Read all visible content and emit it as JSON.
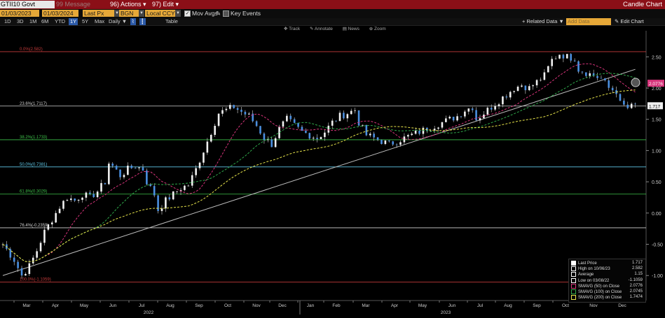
{
  "title_bar": {
    "ticker": "GTII10 Govt",
    "ghost_text": "Message",
    "ghost_prefix": "99",
    "actions_num": "96",
    "actions_label": "Actions",
    "edit_num": "97",
    "edit_label": "Edit",
    "window_title": "Candle Chart"
  },
  "controls": {
    "start_date": "01/03/2023",
    "end_date": "01/03/2024",
    "price_field": "Last Px",
    "source_field": "BGN",
    "currency_field": "Local CCY",
    "mov_avgs_label": "Mov Avgs",
    "key_events_label": "Key Events"
  },
  "periods": [
    "1D",
    "3D",
    "1M",
    "6M",
    "YTD",
    "1Y",
    "5Y",
    "Max"
  ],
  "active_period": "1Y",
  "frequency": "Daily",
  "table_label": "Table",
  "related_data": "Related Data",
  "add_data_placeholder": "Add Data",
  "edit_chart": "Edit Chart",
  "chart_tools": [
    "Track",
    "Annotate",
    "News",
    "Zoom"
  ],
  "colors": {
    "title_bar": "#8b0f17",
    "field": "#e6a838",
    "candle": "#4a8fe0",
    "sma50": "#d6347a",
    "sma100": "#2fa84a",
    "sma200": "#e6e34a",
    "trendline": "#bdbdbd"
  },
  "chart_data": {
    "type": "candlestick",
    "y_ticks": [
      "2.50",
      "2.00",
      "1.50",
      "1.00",
      "0.50",
      "0.00",
      "-0.50",
      "-1.00"
    ],
    "ylim": [
      -1.4,
      2.85
    ],
    "x_month_labels": [
      "Mar",
      "Apr",
      "May",
      "Jun",
      "Jul",
      "Aug",
      "Sep",
      "Oct",
      "Nov",
      "Dec",
      "Jan",
      "Feb",
      "Mar",
      "Apr",
      "May",
      "Jun",
      "Jul",
      "Aug",
      "Sep",
      "Oct",
      "Nov",
      "Dec"
    ],
    "x_year_labels": [
      "2022",
      "2023"
    ],
    "fib_levels": [
      {
        "label": "0.0%(2.582)",
        "value": 2.582,
        "color": "#c43a3a"
      },
      {
        "label": "23.6%(1.7117)",
        "value": 1.7117,
        "color": "#d0d0d0"
      },
      {
        "label": "38.2%(1.1733)",
        "value": 1.1733,
        "color": "#3ec24a"
      },
      {
        "label": "50.0%(0.7381)",
        "value": 0.7381,
        "color": "#5fc8e8"
      },
      {
        "label": "61.8%(0.3029)",
        "value": 0.3029,
        "color": "#3ec24a"
      },
      {
        "label": "76.4%(-0.2359)",
        "value": -0.2359,
        "color": "#d0d0d0"
      },
      {
        "label": "100.0%(-1.1059)",
        "value": -1.1059,
        "color": "#c43a3a"
      }
    ],
    "price_path": [
      [
        0,
        -0.5
      ],
      [
        3,
        -0.75
      ],
      [
        5,
        -1.0
      ],
      [
        7,
        -0.85
      ],
      [
        9,
        -0.6
      ],
      [
        11,
        -0.3
      ],
      [
        13,
        -0.1
      ],
      [
        15,
        0.1
      ],
      [
        17,
        0.25
      ],
      [
        19,
        0.2
      ],
      [
        21,
        0.3
      ],
      [
        23,
        0.25
      ],
      [
        25,
        0.35
      ],
      [
        27,
        0.5
      ],
      [
        28,
        0.8
      ],
      [
        29,
        0.75
      ],
      [
        31,
        0.6
      ],
      [
        33,
        0.7
      ],
      [
        35,
        0.75
      ],
      [
        37,
        0.7
      ],
      [
        38,
        0.5
      ],
      [
        40,
        0.3
      ],
      [
        41,
        0.05
      ],
      [
        43,
        0.2
      ],
      [
        45,
        0.3
      ],
      [
        47,
        0.4
      ],
      [
        49,
        0.45
      ],
      [
        51,
        0.7
      ],
      [
        53,
        1.0
      ],
      [
        55,
        1.3
      ],
      [
        57,
        1.6
      ],
      [
        59,
        1.65
      ],
      [
        61,
        1.7
      ],
      [
        63,
        1.62
      ],
      [
        65,
        1.55
      ],
      [
        67,
        1.4
      ],
      [
        69,
        1.2
      ],
      [
        71,
        1.1
      ],
      [
        73,
        1.35
      ],
      [
        75,
        1.5
      ],
      [
        77,
        1.4
      ],
      [
        79,
        1.3
      ],
      [
        81,
        1.25
      ],
      [
        83,
        1.2
      ],
      [
        85,
        1.3
      ],
      [
        87,
        1.45
      ],
      [
        89,
        1.55
      ],
      [
        91,
        1.6
      ],
      [
        93,
        1.65
      ],
      [
        94,
        1.45
      ],
      [
        96,
        1.25
      ],
      [
        98,
        1.2
      ],
      [
        100,
        1.15
      ],
      [
        102,
        1.1
      ],
      [
        104,
        1.15
      ],
      [
        106,
        1.2
      ],
      [
        108,
        1.25
      ],
      [
        110,
        1.3
      ],
      [
        112,
        1.35
      ],
      [
        114,
        1.4
      ],
      [
        116,
        1.45
      ],
      [
        118,
        1.5
      ],
      [
        120,
        1.55
      ],
      [
        122,
        1.65
      ],
      [
        124,
        1.7
      ],
      [
        125,
        1.5
      ],
      [
        127,
        1.6
      ],
      [
        129,
        1.7
      ],
      [
        131,
        1.8
      ],
      [
        133,
        1.9
      ],
      [
        135,
        2.0
      ],
      [
        137,
        2.05
      ],
      [
        139,
        2.0
      ],
      [
        141,
        2.1
      ],
      [
        143,
        2.2
      ],
      [
        145,
        2.45
      ],
      [
        147,
        2.55
      ],
      [
        149,
        2.5
      ],
      [
        151,
        2.48
      ],
      [
        152,
        2.3
      ],
      [
        154,
        2.25
      ],
      [
        156,
        2.2
      ],
      [
        158,
        2.15
      ],
      [
        160,
        2.0
      ],
      [
        162,
        1.95
      ],
      [
        163,
        1.75
      ],
      [
        165,
        1.68
      ],
      [
        167,
        1.72
      ]
    ],
    "last_price_tag": "1.717",
    "sma100_tag": "2.0776",
    "legend": [
      {
        "label": "Last Price",
        "value": "1.717"
      },
      {
        "label": "High on 10/06/23",
        "value": "2.582"
      },
      {
        "label": "Average",
        "value": "1.15"
      },
      {
        "label": "Low on 03/08/22",
        "value": "-1.1059"
      },
      {
        "label": "SMAVG (50)  on Close",
        "value": "2.0776"
      },
      {
        "label": "SMAVG (100)  on Close",
        "value": "2.0745"
      },
      {
        "label": "SMAVG (200)  on Close",
        "value": "1.7474"
      }
    ]
  }
}
